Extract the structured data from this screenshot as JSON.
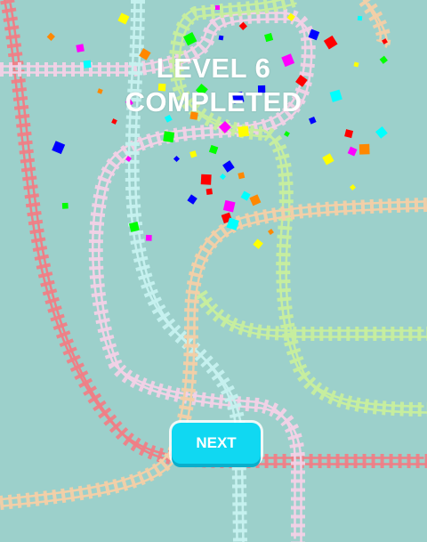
{
  "screen": {
    "title_line1": "LEVEL 6",
    "title_line2": "COMPLETED",
    "next_label": "NEXT"
  },
  "colors": {
    "background": "#9cd0cb",
    "button": "#10d8f2",
    "track_red": "#ef7f86",
    "track_pink": "#f2d1e6",
    "track_cyan": "#c6f1ef",
    "track_green": "#c7ee9e",
    "track_peach": "#f3cfa7",
    "confetti": [
      "#ff00ff",
      "#ffff00",
      "#00ff00",
      "#0000ff",
      "#ff0000",
      "#00ffff",
      "#ff8800"
    ]
  }
}
